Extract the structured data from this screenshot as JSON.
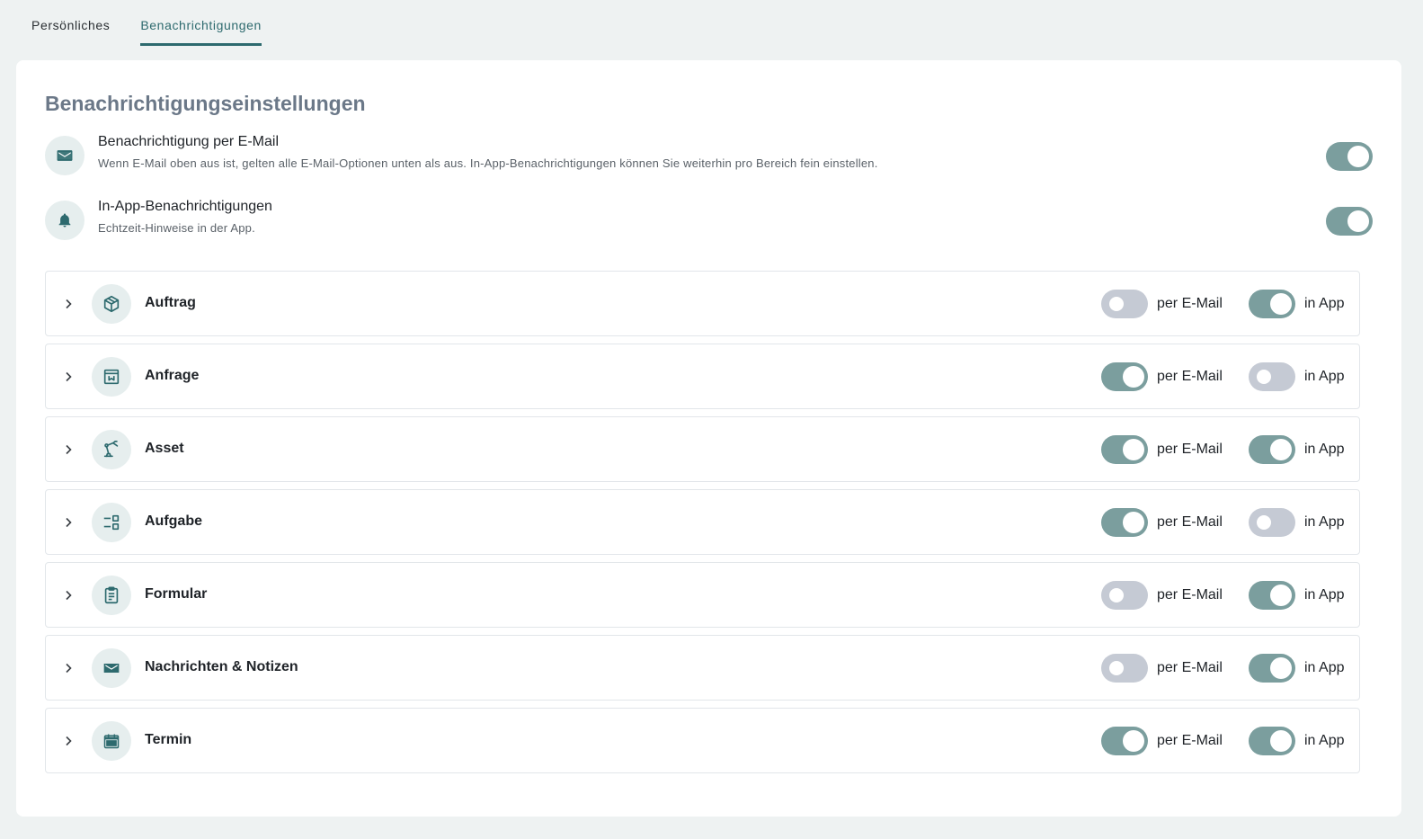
{
  "tabs": [
    {
      "label": "Persönliches",
      "active": false
    },
    {
      "label": "Benachrichtigungen",
      "active": true
    }
  ],
  "page_title": "Benachrichtigungseinstellungen",
  "global": {
    "email": {
      "title": "Benachrichtigung per E-Mail",
      "description": "Wenn E-Mail oben aus ist, gelten alle E-Mail-Optionen unten als aus. In-App-Benachrichtigungen können Sie weiterhin pro Bereich fein einstellen.",
      "icon": "envelope-icon",
      "enabled": true
    },
    "inapp": {
      "title": "In-App-Benachrichtigungen",
      "description": "Echtzeit-Hinweise in der App.",
      "icon": "bell-icon",
      "enabled": true
    }
  },
  "labels": {
    "email": "per E-Mail",
    "app": "in App"
  },
  "sections": [
    {
      "name": "Auftrag",
      "icon": "box-icon",
      "email": false,
      "app": true
    },
    {
      "name": "Anfrage",
      "icon": "inbox-icon",
      "email": true,
      "app": false
    },
    {
      "name": "Asset",
      "icon": "robot-arm-icon",
      "email": true,
      "app": true
    },
    {
      "name": "Aufgabe",
      "icon": "task-list-icon",
      "email": true,
      "app": false
    },
    {
      "name": "Formular",
      "icon": "clipboard-icon",
      "email": false,
      "app": true
    },
    {
      "name": "Nachrichten & Notizen",
      "icon": "envelope-icon",
      "email": false,
      "app": true
    },
    {
      "name": "Termin",
      "icon": "calendar-icon",
      "email": true,
      "app": true
    }
  ],
  "colors": {
    "accent": "#2d6a6e",
    "toggle_on": "#7b9e9e",
    "toggle_off": "#c5cad4",
    "icon_bg": "#e6eeee",
    "title": "#6b7888"
  }
}
